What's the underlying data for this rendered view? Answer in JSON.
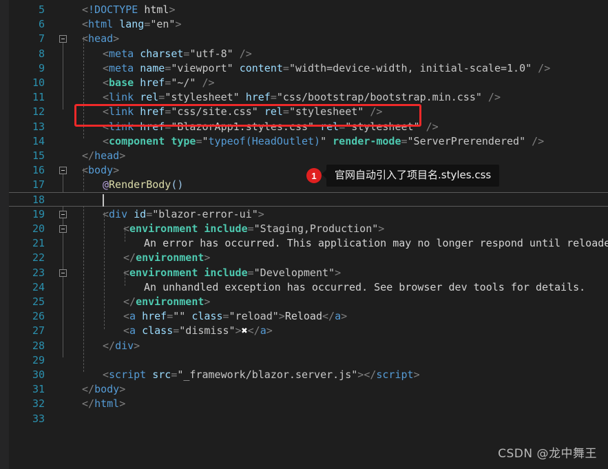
{
  "editor": {
    "language": "razor-html",
    "theme": "dark",
    "colors": {
      "background": "#1e1e1e",
      "gutter_strip": "#252526",
      "line_number": "#2b91af",
      "tag": "#569cd6",
      "tag_helper": "#4ec9b0",
      "attribute": "#9cdcfe",
      "text": "#d4d4d4",
      "punctuation": "#808080",
      "razor_transition": "#b4a0d8",
      "method": "#dcdcaa",
      "annotation_red": "#ef2929",
      "badge_red": "#e02020"
    },
    "first_visible_line": 5,
    "last_visible_line": 33,
    "caret_line": 18,
    "lines": [
      {
        "number": "5",
        "indent": 1,
        "tokens": [
          {
            "text": "<",
            "type": "punct"
          },
          {
            "text": "!DOCTYPE",
            "type": "tag"
          },
          {
            "text": " ",
            "type": "text"
          },
          {
            "text": "html",
            "type": "text"
          },
          {
            "text": ">",
            "type": "punct"
          }
        ]
      },
      {
        "number": "6",
        "indent": 1,
        "tokens": [
          {
            "text": "<",
            "type": "punct"
          },
          {
            "text": "html",
            "type": "tag"
          },
          {
            "text": " ",
            "type": "text"
          },
          {
            "text": "lang",
            "type": "attr"
          },
          {
            "text": "=",
            "type": "punct"
          },
          {
            "text": "\"en\"",
            "type": "val"
          },
          {
            "text": ">",
            "type": "punct"
          }
        ]
      },
      {
        "number": "7",
        "indent": 1,
        "fold": true,
        "tokens": [
          {
            "text": "<",
            "type": "punct"
          },
          {
            "text": "head",
            "type": "tag"
          },
          {
            "text": ">",
            "type": "punct"
          }
        ]
      },
      {
        "number": "8",
        "indent": 2,
        "tokens": [
          {
            "text": "<",
            "type": "punct"
          },
          {
            "text": "meta",
            "type": "tag"
          },
          {
            "text": " ",
            "type": "text"
          },
          {
            "text": "charset",
            "type": "attr"
          },
          {
            "text": "=",
            "type": "punct"
          },
          {
            "text": "\"utf-8\"",
            "type": "val"
          },
          {
            "text": " ",
            "type": "text"
          },
          {
            "text": "/>",
            "type": "punct"
          }
        ]
      },
      {
        "number": "9",
        "indent": 2,
        "tokens": [
          {
            "text": "<",
            "type": "punct"
          },
          {
            "text": "meta",
            "type": "tag"
          },
          {
            "text": " ",
            "type": "text"
          },
          {
            "text": "name",
            "type": "attr"
          },
          {
            "text": "=",
            "type": "punct"
          },
          {
            "text": "\"viewport\"",
            "type": "val"
          },
          {
            "text": " ",
            "type": "text"
          },
          {
            "text": "content",
            "type": "attr"
          },
          {
            "text": "=",
            "type": "punct"
          },
          {
            "text": "\"width=device-width, initial-scale=1.0\"",
            "type": "val"
          },
          {
            "text": " ",
            "type": "text"
          },
          {
            "text": "/>",
            "type": "punct"
          }
        ]
      },
      {
        "number": "10",
        "indent": 2,
        "tokens": [
          {
            "text": "<",
            "type": "punct"
          },
          {
            "text": "base",
            "type": "helper"
          },
          {
            "text": " ",
            "type": "text"
          },
          {
            "text": "href",
            "type": "attr"
          },
          {
            "text": "=",
            "type": "punct"
          },
          {
            "text": "\"~/\"",
            "type": "val"
          },
          {
            "text": " ",
            "type": "text"
          },
          {
            "text": "/>",
            "type": "punct"
          }
        ]
      },
      {
        "number": "11",
        "indent": 2,
        "tokens": [
          {
            "text": "<",
            "type": "punct"
          },
          {
            "text": "link",
            "type": "tag"
          },
          {
            "text": " ",
            "type": "text"
          },
          {
            "text": "rel",
            "type": "attr"
          },
          {
            "text": "=",
            "type": "punct"
          },
          {
            "text": "\"stylesheet\"",
            "type": "val"
          },
          {
            "text": " ",
            "type": "text"
          },
          {
            "text": "href",
            "type": "attr"
          },
          {
            "text": "=",
            "type": "punct"
          },
          {
            "text": "\"css/bootstrap/bootstrap.min.css\"",
            "type": "val"
          },
          {
            "text": " ",
            "type": "text"
          },
          {
            "text": "/>",
            "type": "punct"
          }
        ]
      },
      {
        "number": "12",
        "indent": 2,
        "tokens": [
          {
            "text": "<",
            "type": "punct"
          },
          {
            "text": "link",
            "type": "tag"
          },
          {
            "text": " ",
            "type": "text"
          },
          {
            "text": "href",
            "type": "attr"
          },
          {
            "text": "=",
            "type": "punct"
          },
          {
            "text": "\"css/site.css\"",
            "type": "val"
          },
          {
            "text": " ",
            "type": "text"
          },
          {
            "text": "rel",
            "type": "attr"
          },
          {
            "text": "=",
            "type": "punct"
          },
          {
            "text": "\"stylesheet\"",
            "type": "val"
          },
          {
            "text": " ",
            "type": "text"
          },
          {
            "text": "/>",
            "type": "punct"
          }
        ]
      },
      {
        "number": "13",
        "indent": 2,
        "highlighted": true,
        "tokens": [
          {
            "text": "<",
            "type": "punct"
          },
          {
            "text": "link",
            "type": "tag"
          },
          {
            "text": " ",
            "type": "text"
          },
          {
            "text": "href",
            "type": "attr"
          },
          {
            "text": "=",
            "type": "punct"
          },
          {
            "text": "\"BlazorApp1.styles.css\"",
            "type": "val"
          },
          {
            "text": " ",
            "type": "text"
          },
          {
            "text": "rel",
            "type": "attr"
          },
          {
            "text": "=",
            "type": "punct"
          },
          {
            "text": "\"stylesheet\"",
            "type": "val"
          },
          {
            "text": " ",
            "type": "text"
          },
          {
            "text": "/>",
            "type": "punct"
          }
        ]
      },
      {
        "number": "14",
        "indent": 2,
        "tokens": [
          {
            "text": "<",
            "type": "punct"
          },
          {
            "text": "component",
            "type": "helper"
          },
          {
            "text": " ",
            "type": "text"
          },
          {
            "text": "type",
            "type": "attrh"
          },
          {
            "text": "=",
            "type": "punct"
          },
          {
            "text": "\"",
            "type": "quote"
          },
          {
            "text": "typeof(HeadOutlet)",
            "type": "valb"
          },
          {
            "text": "\"",
            "type": "quote"
          },
          {
            "text": " ",
            "type": "text"
          },
          {
            "text": "render-mode",
            "type": "attrh"
          },
          {
            "text": "=",
            "type": "punct"
          },
          {
            "text": "\"ServerPrerendered\"",
            "type": "val"
          },
          {
            "text": " ",
            "type": "text"
          },
          {
            "text": "/>",
            "type": "punct"
          }
        ]
      },
      {
        "number": "15",
        "indent": 1,
        "tokens": [
          {
            "text": "</",
            "type": "punct"
          },
          {
            "text": "head",
            "type": "tag"
          },
          {
            "text": ">",
            "type": "punct"
          }
        ]
      },
      {
        "number": "16",
        "indent": 1,
        "fold": true,
        "tokens": [
          {
            "text": "<",
            "type": "punct"
          },
          {
            "text": "body",
            "type": "tag"
          },
          {
            "text": ">",
            "type": "punct"
          }
        ]
      },
      {
        "number": "17",
        "indent": 2,
        "tokens": [
          {
            "text": "@",
            "type": "razor"
          },
          {
            "text": "RenderBody",
            "type": "method"
          },
          {
            "text": "()",
            "type": "paren"
          }
        ]
      },
      {
        "number": "18",
        "indent": 2,
        "caret": true,
        "tokens": []
      },
      {
        "number": "19",
        "indent": 2,
        "fold": true,
        "tokens": [
          {
            "text": "<",
            "type": "punct"
          },
          {
            "text": "div",
            "type": "tag"
          },
          {
            "text": " ",
            "type": "text"
          },
          {
            "text": "id",
            "type": "attr"
          },
          {
            "text": "=",
            "type": "punct"
          },
          {
            "text": "\"blazor-error-ui\"",
            "type": "val"
          },
          {
            "text": ">",
            "type": "punct"
          }
        ]
      },
      {
        "number": "20",
        "indent": 3,
        "fold": true,
        "tokens": [
          {
            "text": "<",
            "type": "punct"
          },
          {
            "text": "environment",
            "type": "helper"
          },
          {
            "text": " ",
            "type": "text"
          },
          {
            "text": "include",
            "type": "attrh"
          },
          {
            "text": "=",
            "type": "punct"
          },
          {
            "text": "\"Staging,Production\"",
            "type": "val"
          },
          {
            "text": ">",
            "type": "punct"
          }
        ]
      },
      {
        "number": "21",
        "indent": 4,
        "tokens": [
          {
            "text": "An error has occurred. This application may no longer respond until reloaded.",
            "type": "text"
          }
        ]
      },
      {
        "number": "22",
        "indent": 3,
        "tokens": [
          {
            "text": "</",
            "type": "punct"
          },
          {
            "text": "environment",
            "type": "helper"
          },
          {
            "text": ">",
            "type": "punct"
          }
        ]
      },
      {
        "number": "23",
        "indent": 3,
        "fold": true,
        "tokens": [
          {
            "text": "<",
            "type": "punct"
          },
          {
            "text": "environment",
            "type": "helper"
          },
          {
            "text": " ",
            "type": "text"
          },
          {
            "text": "include",
            "type": "attrh"
          },
          {
            "text": "=",
            "type": "punct"
          },
          {
            "text": "\"Development\"",
            "type": "val"
          },
          {
            "text": ">",
            "type": "punct"
          }
        ]
      },
      {
        "number": "24",
        "indent": 4,
        "tokens": [
          {
            "text": "An unhandled exception has occurred. See browser dev tools for details.",
            "type": "text"
          }
        ]
      },
      {
        "number": "25",
        "indent": 3,
        "tokens": [
          {
            "text": "</",
            "type": "punct"
          },
          {
            "text": "environment",
            "type": "helper"
          },
          {
            "text": ">",
            "type": "punct"
          }
        ]
      },
      {
        "number": "26",
        "indent": 3,
        "tokens": [
          {
            "text": "<",
            "type": "punct"
          },
          {
            "text": "a",
            "type": "tag"
          },
          {
            "text": " ",
            "type": "text"
          },
          {
            "text": "href",
            "type": "attr"
          },
          {
            "text": "=",
            "type": "punct"
          },
          {
            "text": "\"\"",
            "type": "val"
          },
          {
            "text": " ",
            "type": "text"
          },
          {
            "text": "class",
            "type": "attr"
          },
          {
            "text": "=",
            "type": "punct"
          },
          {
            "text": "\"reload\"",
            "type": "val"
          },
          {
            "text": ">",
            "type": "punct"
          },
          {
            "text": "Reload",
            "type": "text"
          },
          {
            "text": "</",
            "type": "punct"
          },
          {
            "text": "a",
            "type": "tag"
          },
          {
            "text": ">",
            "type": "punct"
          }
        ]
      },
      {
        "number": "27",
        "indent": 3,
        "tokens": [
          {
            "text": "<",
            "type": "punct"
          },
          {
            "text": "a",
            "type": "tag"
          },
          {
            "text": " ",
            "type": "text"
          },
          {
            "text": "class",
            "type": "attr"
          },
          {
            "text": "=",
            "type": "punct"
          },
          {
            "text": "\"dismiss\"",
            "type": "val"
          },
          {
            "text": ">",
            "type": "punct"
          },
          {
            "text": "✖",
            "type": "x"
          },
          {
            "text": "</",
            "type": "punct"
          },
          {
            "text": "a",
            "type": "tag"
          },
          {
            "text": ">",
            "type": "punct"
          }
        ]
      },
      {
        "number": "28",
        "indent": 2,
        "tokens": [
          {
            "text": "</",
            "type": "punct"
          },
          {
            "text": "div",
            "type": "tag"
          },
          {
            "text": ">",
            "type": "punct"
          }
        ]
      },
      {
        "number": "29",
        "indent": 2,
        "tokens": []
      },
      {
        "number": "30",
        "indent": 2,
        "tokens": [
          {
            "text": "<",
            "type": "punct"
          },
          {
            "text": "script",
            "type": "tag"
          },
          {
            "text": " ",
            "type": "text"
          },
          {
            "text": "src",
            "type": "attr"
          },
          {
            "text": "=",
            "type": "punct"
          },
          {
            "text": "\"_framework/blazor.server.js\"",
            "type": "val"
          },
          {
            "text": ">",
            "type": "punct"
          },
          {
            "text": "</",
            "type": "punct"
          },
          {
            "text": "script",
            "type": "tag"
          },
          {
            "text": ">",
            "type": "punct"
          }
        ]
      },
      {
        "number": "31",
        "indent": 1,
        "tokens": [
          {
            "text": "</",
            "type": "punct"
          },
          {
            "text": "body",
            "type": "tag"
          },
          {
            "text": ">",
            "type": "punct"
          }
        ]
      },
      {
        "number": "32",
        "indent": 1,
        "tokens": [
          {
            "text": "</",
            "type": "punct"
          },
          {
            "text": "html",
            "type": "tag"
          },
          {
            "text": ">",
            "type": "punct"
          }
        ]
      },
      {
        "number": "33",
        "indent": 0,
        "tokens": []
      }
    ]
  },
  "annotations": {
    "highlight_rect": {
      "target_lines": "12-13",
      "color": "#ef2929"
    },
    "callout": {
      "badge": "1",
      "text": "官网自动引入了项目名.styles.css"
    }
  },
  "watermark": {
    "text": "CSDN @龙中舞王"
  }
}
